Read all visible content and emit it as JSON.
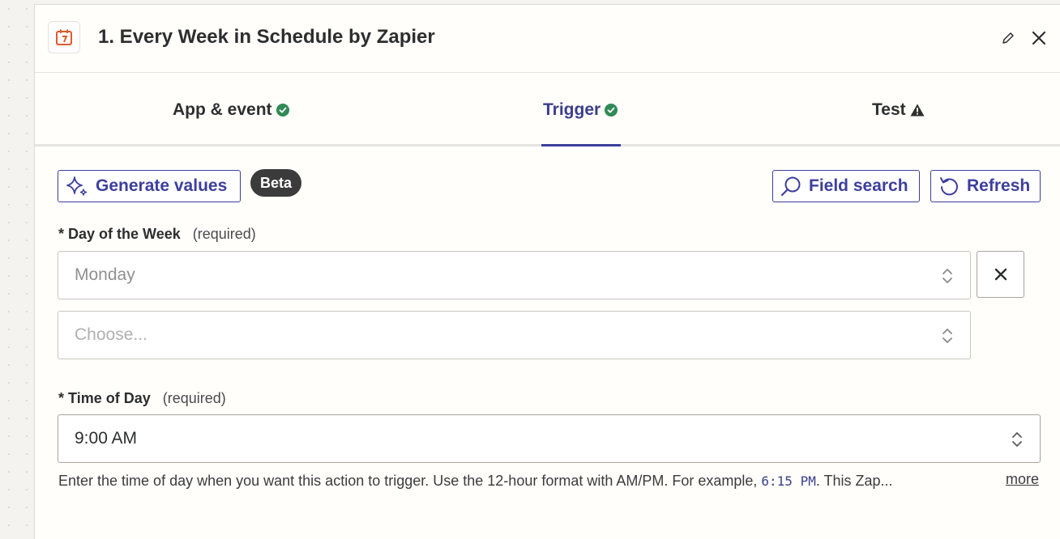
{
  "header": {
    "title": "1. Every Week in Schedule by Zapier",
    "app_icon": "schedule-calendar-icon",
    "edit_icon": "pencil-icon",
    "close_icon": "close-icon"
  },
  "tabs": [
    {
      "label": "App & event",
      "status": "check",
      "active": false
    },
    {
      "label": "Trigger",
      "status": "check",
      "active": true
    },
    {
      "label": "Test",
      "status": "warning",
      "active": false
    }
  ],
  "toolbar": {
    "generate_label": "Generate values",
    "beta_label": "Beta",
    "field_search_label": "Field search",
    "refresh_label": "Refresh"
  },
  "fields": {
    "day_of_week": {
      "label": "Day of the Week",
      "required_marker": "*",
      "required_text": "(required)",
      "value": "Monday",
      "second_placeholder": "Choose..."
    },
    "time_of_day": {
      "label": "Time of Day",
      "required_marker": "*",
      "required_text": "(required)",
      "value": "9:00 AM",
      "help_prefix": "Enter the time of day when you want this action to trigger. Use the 12-hour format with AM/PM. For example, ",
      "help_example": "6:15 PM",
      "help_suffix": ". This Zap...",
      "more_label": "more"
    }
  },
  "colors": {
    "accent": "#3d3f9c",
    "success": "#2f8a55",
    "brand_orange": "#e05a2b"
  }
}
